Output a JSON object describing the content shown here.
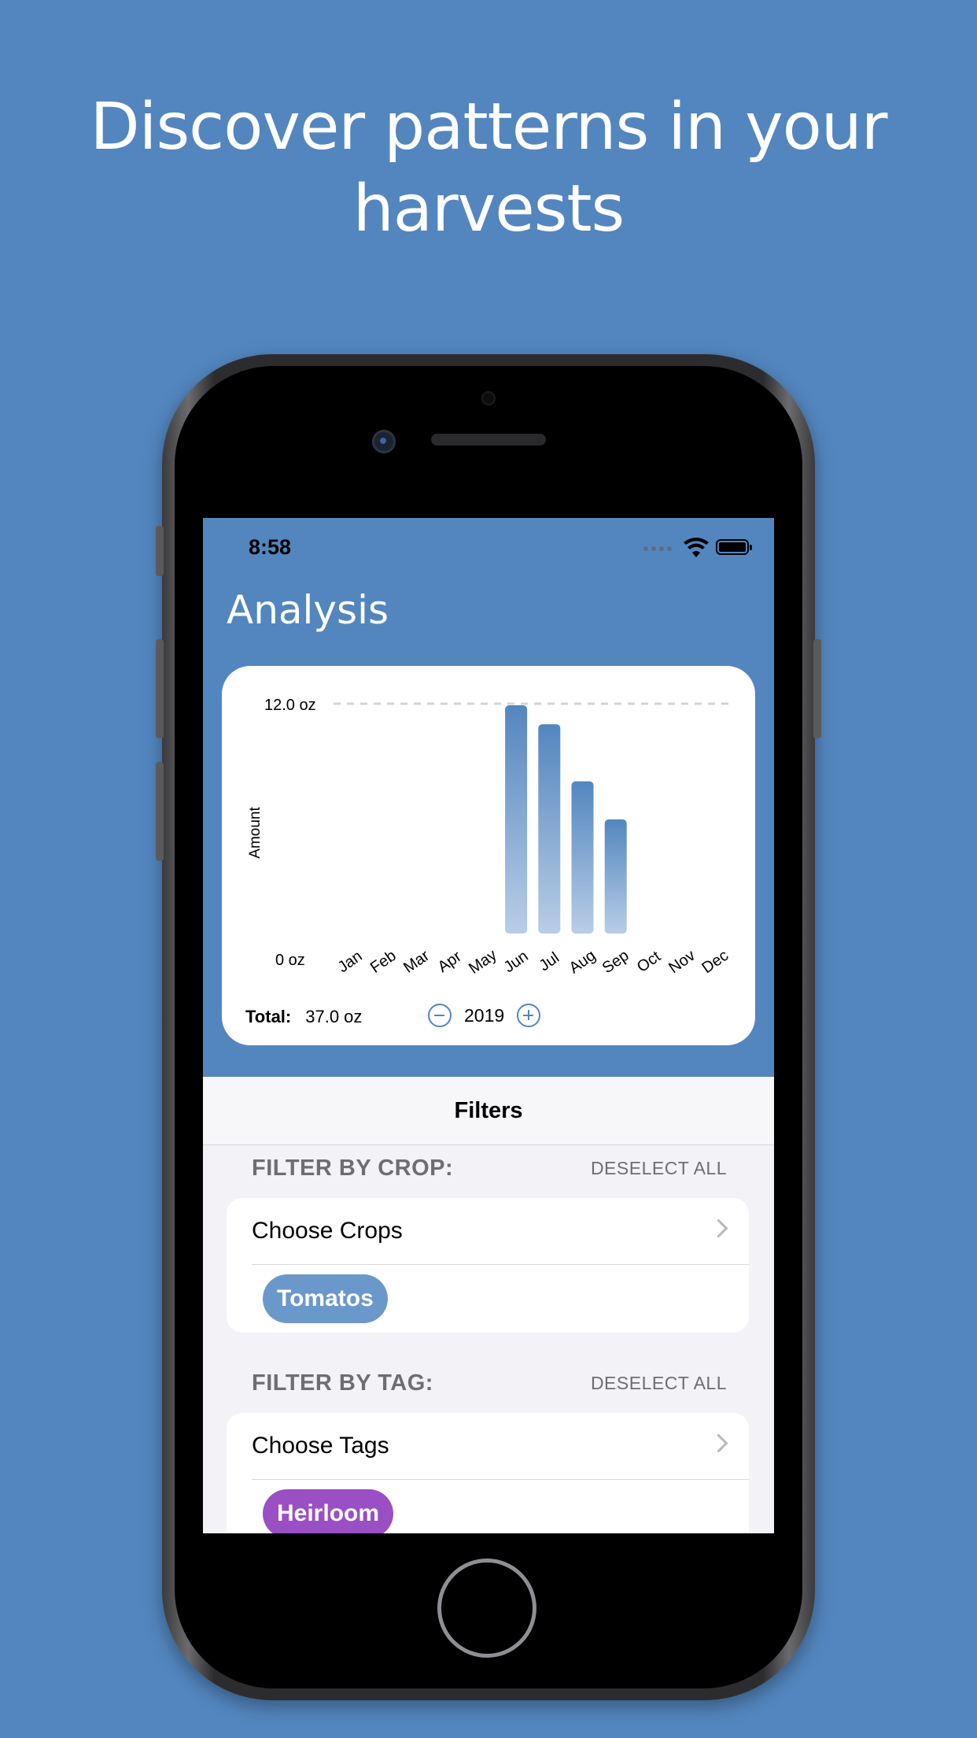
{
  "headline": {
    "line1": "Discover patterns in your",
    "line2": "harvests"
  },
  "status_bar": {
    "time": "8:58"
  },
  "nav": {
    "title": "Analysis"
  },
  "chart_data": {
    "type": "bar",
    "categories": [
      "Jan",
      "Feb",
      "Mar",
      "Apr",
      "May",
      "Jun",
      "Jul",
      "Aug",
      "Sep",
      "Oct",
      "Nov",
      "Dec"
    ],
    "values": [
      0,
      0,
      0,
      0,
      0,
      12.0,
      11.0,
      8.0,
      6.0,
      0,
      0,
      0
    ],
    "ylabel": "Amount",
    "ymax_label": "12.0 oz",
    "ymin_label": "0 oz",
    "ylim": [
      0,
      12.0
    ],
    "bar_color": "#5386bf"
  },
  "summary": {
    "total_label": "Total:",
    "total_value": "37.0 oz",
    "year": "2019"
  },
  "filters": {
    "title": "Filters",
    "crop": {
      "header": "FILTER BY CROP:",
      "deselect": "DESELECT ALL",
      "row_label": "Choose Crops",
      "chip": {
        "label": "Tomatos",
        "color": "#6a98cb"
      }
    },
    "tag": {
      "header": "FILTER BY TAG:",
      "deselect": "DESELECT ALL",
      "row_label": "Choose Tags",
      "chip": {
        "label": "Heirloom",
        "color": "#9a4fc4"
      }
    }
  },
  "colors": {
    "background": "#5386bf",
    "accent": "#5386bf"
  }
}
